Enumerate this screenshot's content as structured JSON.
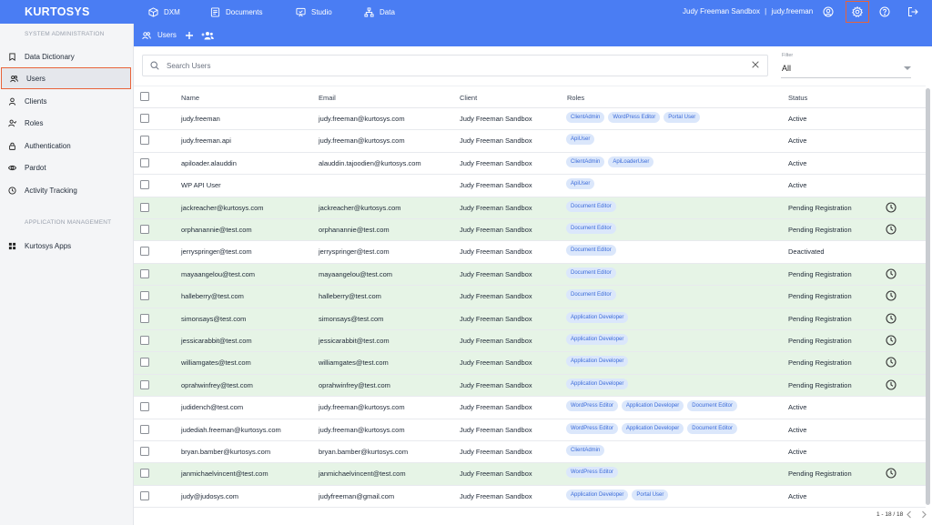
{
  "topbar": {
    "logo": "KURTOSYS",
    "nav": [
      {
        "label": "DXM",
        "icon": "cube-icon"
      },
      {
        "label": "Documents",
        "icon": "document-icon"
      },
      {
        "label": "Studio",
        "icon": "studio-icon"
      },
      {
        "label": "Data",
        "icon": "hierarchy-icon"
      }
    ],
    "tenant": "Judy Freeman Sandbox",
    "separator": "|",
    "user": "judy.freeman"
  },
  "sidebar": {
    "section_admin": "SYSTEM ADMINISTRATION",
    "items": [
      {
        "label": "Data Dictionary",
        "icon": "bookmark-icon"
      },
      {
        "label": "Users",
        "icon": "users-icon"
      },
      {
        "label": "Clients",
        "icon": "user-icon"
      },
      {
        "label": "Roles",
        "icon": "roles-icon"
      },
      {
        "label": "Authentication",
        "icon": "lock-icon"
      },
      {
        "label": "Pardot",
        "icon": "eye-icon"
      },
      {
        "label": "Activity Tracking",
        "icon": "history-icon"
      }
    ],
    "section_apps": "APPLICATION MANAGEMENT",
    "app_items": [
      {
        "label": "Kurtosys Apps",
        "icon": "grid-icon"
      }
    ]
  },
  "subheader": {
    "title": "Users"
  },
  "search": {
    "placeholder": "Search Users",
    "value": ""
  },
  "filter": {
    "label": "Filter",
    "value": "All"
  },
  "table": {
    "headers": [
      "Name",
      "Email",
      "Client",
      "Roles",
      "Status"
    ],
    "rows": [
      {
        "name": "judy.freeman",
        "email": "judy.freeman@kurtosys.com",
        "client": "Judy Freeman Sandbox",
        "roles": [
          "ClientAdmin",
          "WordPress Editor",
          "Portal User"
        ],
        "status": "Active",
        "pending": false
      },
      {
        "name": "judy.freeman.api",
        "email": "judy.freeman@kurtosys.com",
        "client": "Judy Freeman Sandbox",
        "roles": [
          "ApiUser"
        ],
        "status": "Active",
        "pending": false
      },
      {
        "name": "apiloader.alauddin",
        "email": "alauddin.tajoodien@kurtosys.com",
        "client": "Judy Freeman Sandbox",
        "roles": [
          "ClientAdmin",
          "ApiLoaderUser"
        ],
        "status": "Active",
        "pending": false
      },
      {
        "name": "WP API User",
        "email": "",
        "client": "Judy Freeman Sandbox",
        "roles": [
          "ApiUser"
        ],
        "status": "Active",
        "pending": false
      },
      {
        "name": "jackreacher@kurtosys.com",
        "email": "jackreacher@kurtosys.com",
        "client": "Judy Freeman Sandbox",
        "roles": [
          "Document Editor"
        ],
        "status": "Pending Registration",
        "pending": true
      },
      {
        "name": "orphanannie@test.com",
        "email": "orphanannie@test.com",
        "client": "Judy Freeman Sandbox",
        "roles": [
          "Document Editor"
        ],
        "status": "Pending Registration",
        "pending": true
      },
      {
        "name": "jerryspringer@test.com",
        "email": "jerryspringer@test.com",
        "client": "Judy Freeman Sandbox",
        "roles": [
          "Document Editor"
        ],
        "status": "Deactivated",
        "pending": false
      },
      {
        "name": "mayaangelou@test.com",
        "email": "mayaangelou@test.com",
        "client": "Judy Freeman Sandbox",
        "roles": [
          "Document Editor"
        ],
        "status": "Pending Registration",
        "pending": true
      },
      {
        "name": "halleberry@test.com",
        "email": "halleberry@test.com",
        "client": "Judy Freeman Sandbox",
        "roles": [
          "Document Editor"
        ],
        "status": "Pending Registration",
        "pending": true
      },
      {
        "name": "simonsays@test.com",
        "email": "simonsays@test.com",
        "client": "Judy Freeman Sandbox",
        "roles": [
          "Application Developer"
        ],
        "status": "Pending Registration",
        "pending": true
      },
      {
        "name": "jessicarabbit@test.com",
        "email": "jessicarabbit@test.com",
        "client": "Judy Freeman Sandbox",
        "roles": [
          "Application Developer"
        ],
        "status": "Pending Registration",
        "pending": true
      },
      {
        "name": "williamgates@test.com",
        "email": "williamgates@test.com",
        "client": "Judy Freeman Sandbox",
        "roles": [
          "Application Developer"
        ],
        "status": "Pending Registration",
        "pending": true
      },
      {
        "name": "oprahwinfrey@test.com",
        "email": "oprahwinfrey@test.com",
        "client": "Judy Freeman Sandbox",
        "roles": [
          "Application Developer"
        ],
        "status": "Pending Registration",
        "pending": true
      },
      {
        "name": "judidench@test.com",
        "email": "judy.freeman@kurtosys.com",
        "client": "Judy Freeman Sandbox",
        "roles": [
          "WordPress Editor",
          "Application Developer",
          "Document Editor"
        ],
        "status": "Active",
        "pending": false
      },
      {
        "name": "judediah.freeman@kurtosys.com",
        "email": "judy.freeman@kurtosys.com",
        "client": "Judy Freeman Sandbox",
        "roles": [
          "WordPress Editor",
          "Application Developer",
          "Document Editor"
        ],
        "status": "Active",
        "pending": false
      },
      {
        "name": "bryan.bamber@kurtosys.com",
        "email": "bryan.bamber@kurtosys.com",
        "client": "Judy Freeman Sandbox",
        "roles": [
          "ClientAdmin"
        ],
        "status": "Active",
        "pending": false
      },
      {
        "name": "janmichaelvincent@test.com",
        "email": "janmichaelvincent@test.com",
        "client": "Judy Freeman Sandbox",
        "roles": [
          "WordPress Editor"
        ],
        "status": "Pending Registration",
        "pending": true
      },
      {
        "name": "judy@judosys.com",
        "email": "judyfreeman@gmail.com",
        "client": "Judy Freeman Sandbox",
        "roles": [
          "Application Developer",
          "Portal User"
        ],
        "status": "Active",
        "pending": false
      }
    ]
  },
  "pagination": {
    "label": "1 - 18 / 18"
  },
  "colors": {
    "brand": "#4a7df3",
    "highlight": "#e8633a",
    "pending_row": "#e6f4e6",
    "tag_bg": "#dbe7fb",
    "tag_text": "#3b6bd9"
  }
}
